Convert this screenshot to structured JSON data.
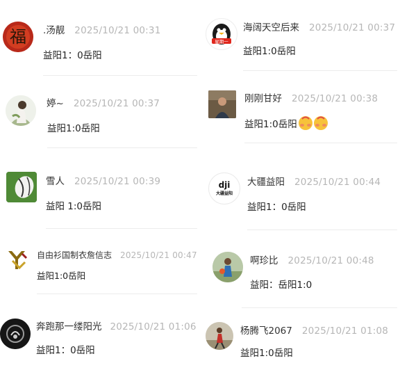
{
  "comments_left": [
    {
      "username": ".汤靓",
      "time": "2025/10/21 00:31",
      "text": "益阳1：0岳阳",
      "avatar": "fu-character-avatar"
    },
    {
      "username": "婷~",
      "time": "2025/10/21 00:37",
      "text": "益阳1:0岳阳",
      "avatar": "girl-photo-avatar"
    },
    {
      "username": "雪人",
      "time": "2025/10/21 00:39",
      "text": "益阳 1:0岳阳",
      "avatar": "rugby-ball-avatar"
    },
    {
      "username": "自由衫国制衣詹信志",
      "time": "2025/10/21 00:47",
      "text": "益阳1:0岳阳",
      "avatar": "yy-logo-avatar"
    },
    {
      "username": "奔跑那一缕阳光",
      "time": "2025/10/21 01:06",
      "text": "益阳1：0岳阳",
      "avatar": "dark-photo-avatar"
    }
  ],
  "comments_right": [
    {
      "username": "海阔天空后来",
      "time": "2025/10/21 00:37",
      "text": "益阳1:0岳阳",
      "avatar": "penguin-avatar",
      "avatar_label": "星期一"
    },
    {
      "username": "刚刚甘好",
      "time": "2025/10/21 00:38",
      "text": "益阳1:0岳阳",
      "avatar": "man-photo-avatar",
      "emoji": "shy-face-emoji"
    },
    {
      "username": "大疆益阳",
      "time": "2025/10/21 00:44",
      "text": "益阳1：0岳阳",
      "avatar": "dji-logo-avatar",
      "avatar_logo": "dji",
      "avatar_label": "大疆益阳"
    },
    {
      "username": "啊珍比",
      "time": "2025/10/21 00:48",
      "text": "益阳：岳阳1:0",
      "avatar": "person-outdoor-avatar"
    },
    {
      "username": "杨腾飞2067",
      "time": "2025/10/21 01:08",
      "text": "益阳1:0岳阳",
      "avatar": "runner-photo-avatar"
    }
  ],
  "colors": {
    "username": "#333333",
    "timestamp": "#b6b6b6",
    "text": "#222222",
    "divider": "#ececec"
  }
}
